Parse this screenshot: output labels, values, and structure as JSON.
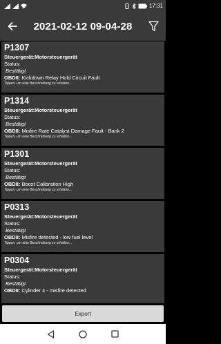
{
  "status_bar": {
    "time": "17:31",
    "battery": "100"
  },
  "app_bar": {
    "title": "2021-02-12 09-04-28"
  },
  "faults": [
    {
      "code": "P1307",
      "ecu": "Steuergerät:Motorsteuergerät",
      "status_label": "Status:",
      "status_value": "Bestätigt",
      "desc_prefix": "OBDII:",
      "desc": "Kickdown Relay Hold Circuit Fault",
      "hint": "Tippen, um eine Beschreibung zu erhalten..."
    },
    {
      "code": "P1314",
      "ecu": "Steuergerät:Motorsteuergerät",
      "status_label": "Status:",
      "status_value": "Bestätigt",
      "desc_prefix": "OBDII:",
      "desc": "Misfire Rate Catalyst Damage Fault - Bank 2",
      "hint": "Tippen, um eine Beschreibung zu erhalten..."
    },
    {
      "code": "P1301",
      "ecu": "Steuergerät:Motorsteuergerät",
      "status_label": "Status:",
      "status_value": "Bestätigt",
      "desc_prefix": "OBDII:",
      "desc": "Boost Calibration High",
      "hint": "Tippen, um eine Beschreibung zu erhalten..."
    },
    {
      "code": "P0313",
      "ecu": "Steuergerät:Motorsteuergerät",
      "status_label": "Status:",
      "status_value": "Bestätigt",
      "desc_prefix": "OBDII:",
      "desc": "Misfire detected - low fuel level",
      "hint": "Tippen, um eine Beschreibung zu erhalten..."
    },
    {
      "code": "P0304",
      "ecu": "Steuergerät:Motorsteuergerät",
      "status_label": "Status:",
      "status_value": "Bestätigt",
      "desc_prefix": "OBDII:",
      "desc": "Cylinder 4 - misfire detected",
      "hint": ""
    }
  ],
  "footer": {
    "export_label": "Export"
  }
}
